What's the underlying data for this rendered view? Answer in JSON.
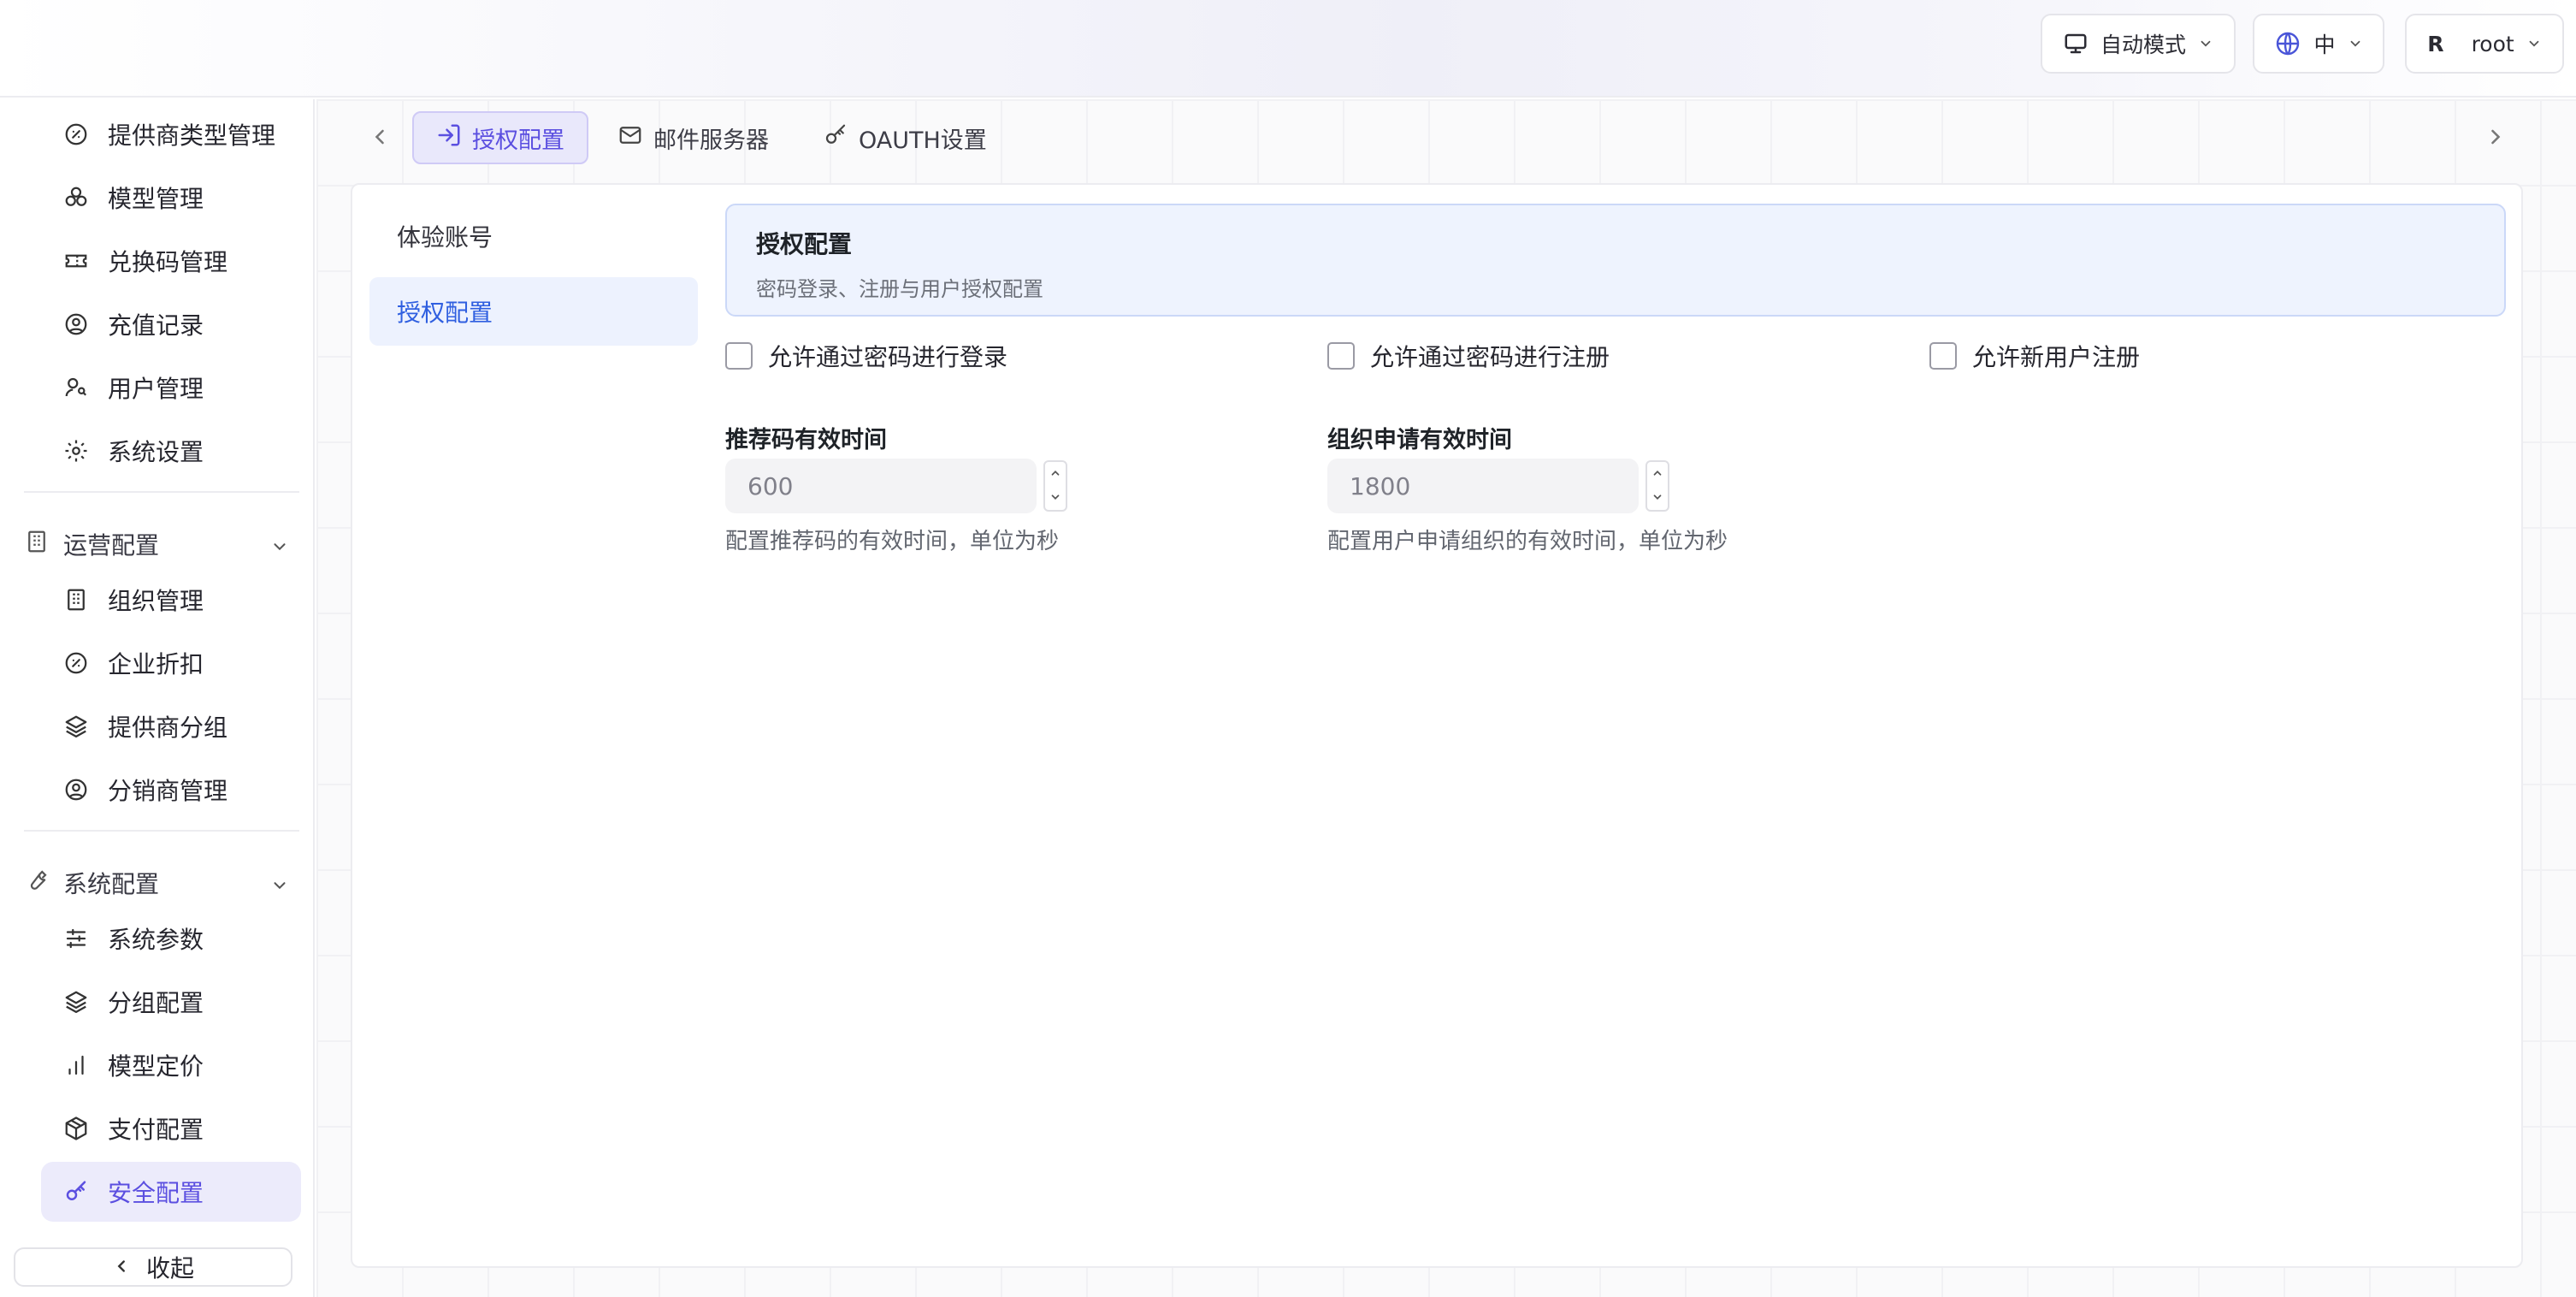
{
  "header": {
    "mode_label": "自动模式",
    "lang_label": "中",
    "user_initial": "R",
    "user_name": "root"
  },
  "sidebar": {
    "top_items": [
      {
        "label": "提供商类型管理",
        "icon": "gauge-icon"
      },
      {
        "label": "模型管理",
        "icon": "boxes-icon"
      },
      {
        "label": "兑换码管理",
        "icon": "ticket-icon"
      },
      {
        "label": "充值记录",
        "icon": "user-circle-icon"
      },
      {
        "label": "用户管理",
        "icon": "user-key-icon"
      },
      {
        "label": "系统设置",
        "icon": "gear-icon"
      }
    ],
    "groups": [
      {
        "label": "运营配置",
        "icon": "building-icon",
        "items": [
          {
            "label": "组织管理",
            "icon": "building-icon"
          },
          {
            "label": "企业折扣",
            "icon": "gauge-icon"
          },
          {
            "label": "提供商分组",
            "icon": "layers-icon"
          },
          {
            "label": "分销商管理",
            "icon": "user-circle-icon"
          }
        ]
      },
      {
        "label": "系统配置",
        "icon": "wrench-icon",
        "items": [
          {
            "label": "系统参数",
            "icon": "sliders-icon"
          },
          {
            "label": "分组配置",
            "icon": "layers-icon"
          },
          {
            "label": "模型定价",
            "icon": "bar-chart-icon"
          },
          {
            "label": "支付配置",
            "icon": "package-icon"
          },
          {
            "label": "安全配置",
            "icon": "key-icon"
          }
        ]
      }
    ],
    "collapse_label": "收起"
  },
  "tabs": [
    {
      "label": "授权配置",
      "icon": "login-icon",
      "active": true
    },
    {
      "label": "邮件服务器",
      "icon": "mail-icon",
      "active": false
    },
    {
      "label": "OAUTH设置",
      "icon": "key-icon",
      "active": false
    }
  ],
  "sub_nav": [
    {
      "label": "体验账号",
      "active": false
    },
    {
      "label": "授权配置",
      "active": true
    }
  ],
  "section": {
    "title": "授权配置",
    "description": "密码登录、注册与用户授权配置"
  },
  "checkboxes": [
    {
      "label": "允许通过密码进行登录",
      "checked": false
    },
    {
      "label": "允许通过密码进行注册",
      "checked": false
    },
    {
      "label": "允许新用户注册",
      "checked": false
    }
  ],
  "fields": [
    {
      "label": "推荐码有效时间",
      "value": "600",
      "help": "配置推荐码的有效时间，单位为秒"
    },
    {
      "label": "组织申请有效时间",
      "value": "1800",
      "help": "配置用户申请组织的有效时间，单位为秒"
    }
  ],
  "colors": {
    "accent": "#5b4fe0",
    "active_blue": "#2f5fe0"
  }
}
